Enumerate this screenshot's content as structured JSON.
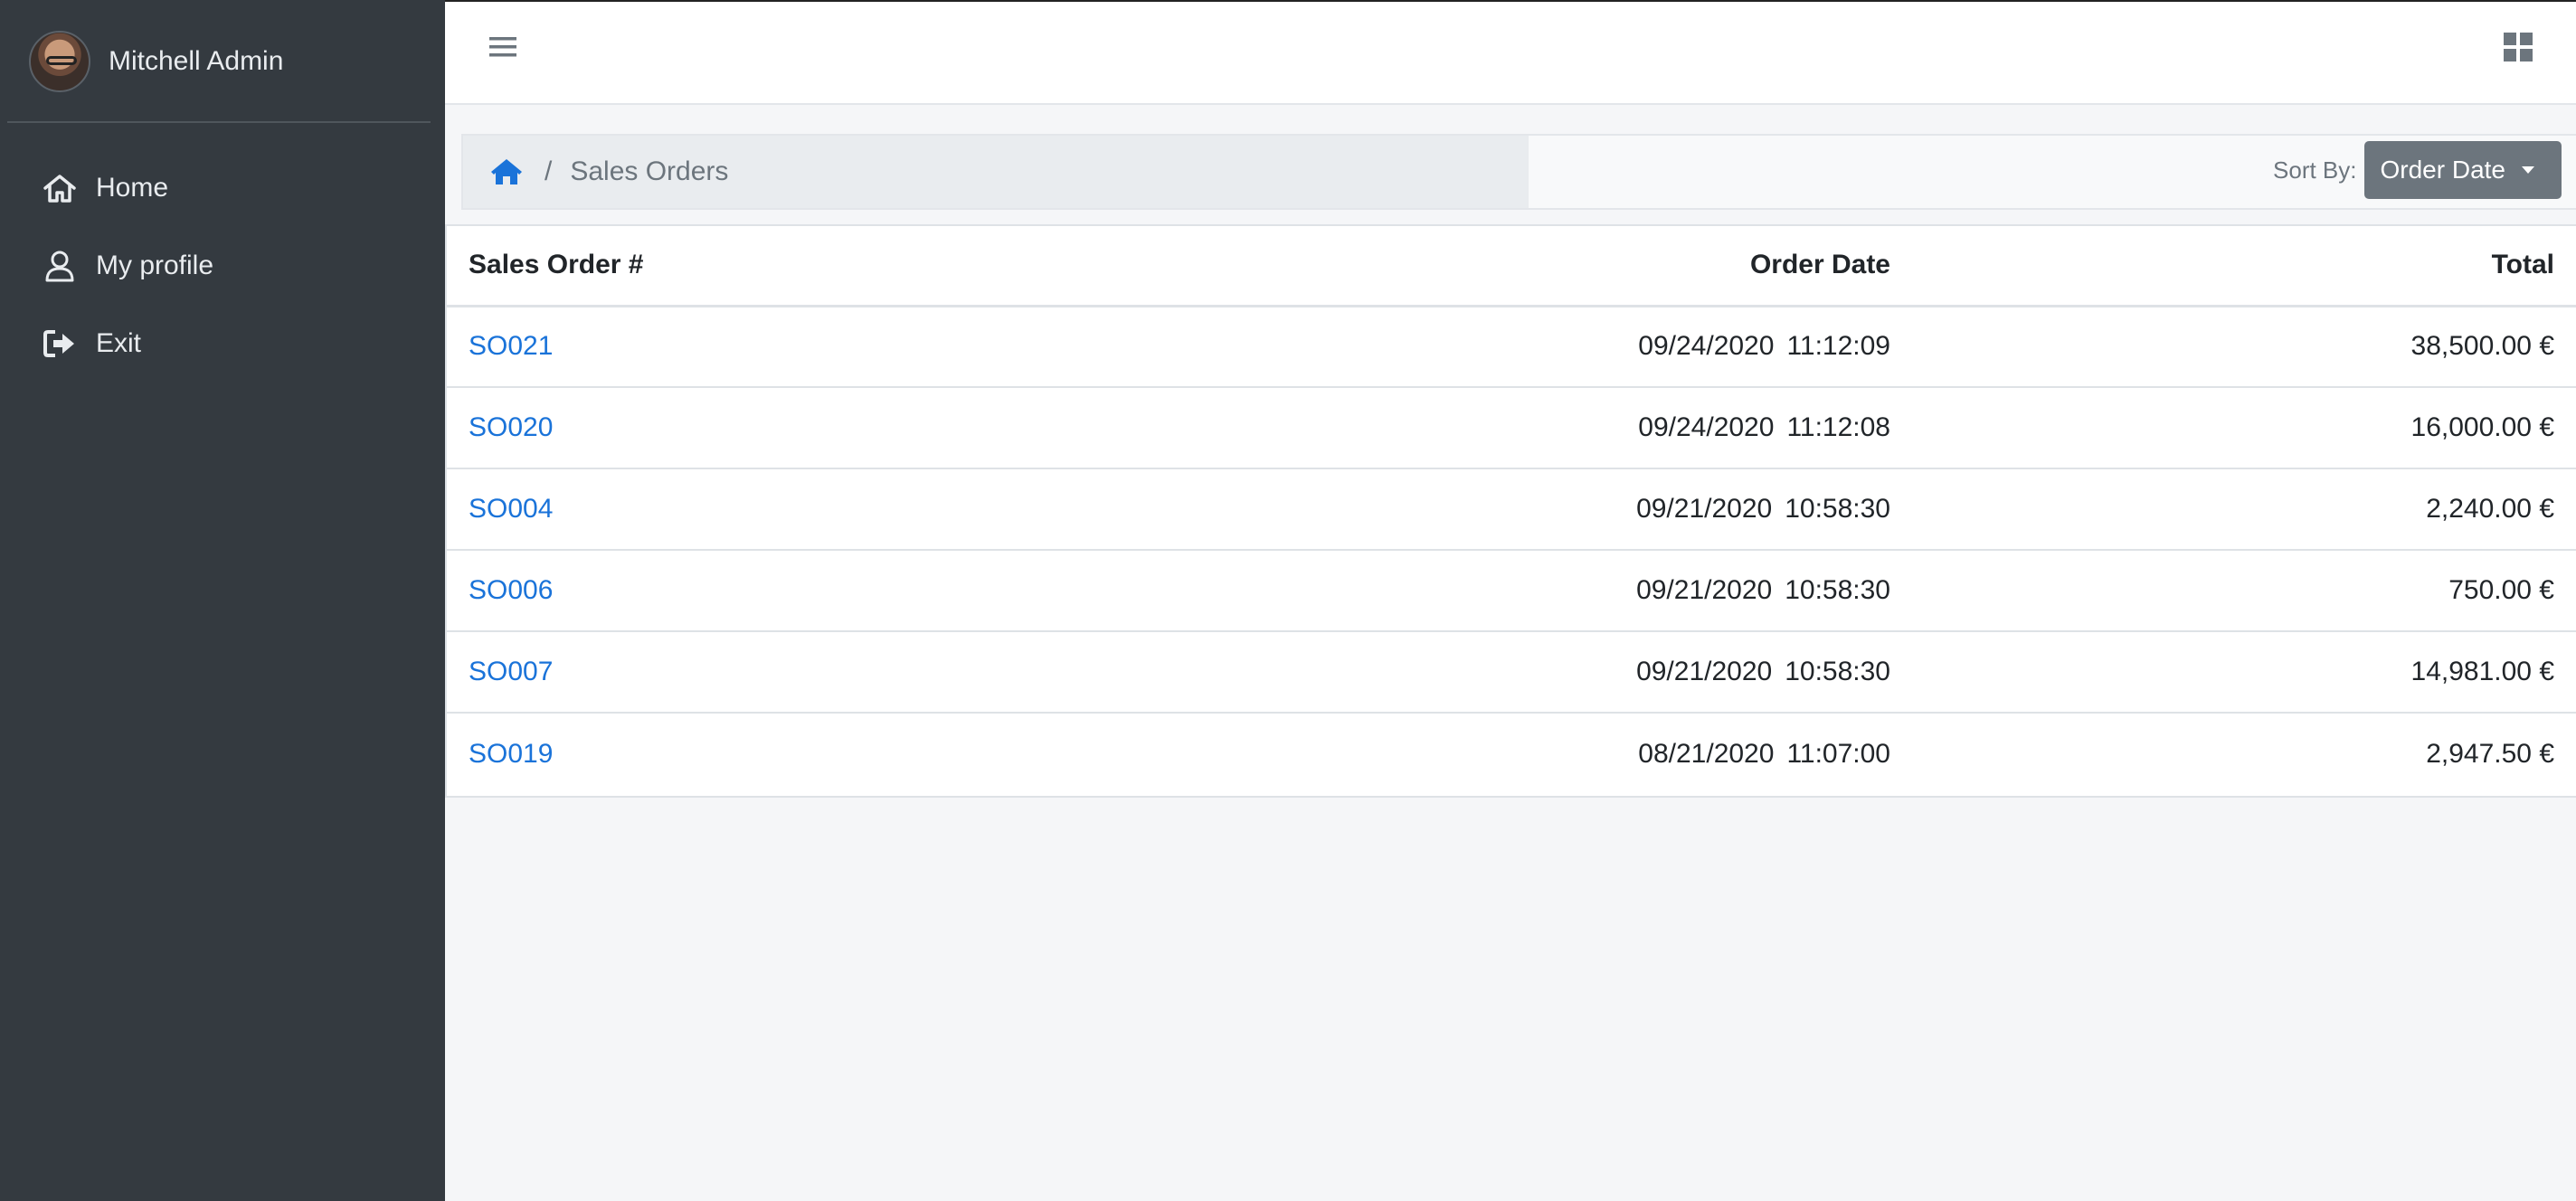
{
  "user": {
    "name": "Mitchell Admin"
  },
  "sidebar": {
    "items": [
      {
        "label": "Home",
        "icon": "home-icon"
      },
      {
        "label": "My profile",
        "icon": "user-icon"
      },
      {
        "label": "Exit",
        "icon": "sign-out-icon"
      }
    ]
  },
  "topbar": {
    "menu_icon": "hamburger-icon",
    "apps_icon": "apps-grid-icon"
  },
  "breadcrumb": {
    "home_icon": "home-icon",
    "separator": "/",
    "current": "Sales Orders"
  },
  "sort": {
    "label": "Sort By:",
    "value": "Order Date"
  },
  "table": {
    "headers": [
      "Sales Order #",
      "Order Date",
      "Total"
    ],
    "rows": [
      {
        "order": "SO021",
        "date": "09/24/2020",
        "time": "11:12:09",
        "total": "38,500.00 €"
      },
      {
        "order": "SO020",
        "date": "09/24/2020",
        "time": "11:12:08",
        "total": "16,000.00 €"
      },
      {
        "order": "SO004",
        "date": "09/21/2020",
        "time": "10:58:30",
        "total": "2,240.00 €"
      },
      {
        "order": "SO006",
        "date": "09/21/2020",
        "time": "10:58:30",
        "total": "750.00 €"
      },
      {
        "order": "SO007",
        "date": "09/21/2020",
        "time": "10:58:30",
        "total": "14,981.00 €"
      },
      {
        "order": "SO019",
        "date": "08/21/2020",
        "time": "11:07:00",
        "total": "2,947.50 €"
      }
    ]
  },
  "colors": {
    "sidebar_bg": "#343a40",
    "link": "#1a73d9",
    "sort_button_bg": "#6c757d",
    "page_bg": "#f5f6f8"
  }
}
